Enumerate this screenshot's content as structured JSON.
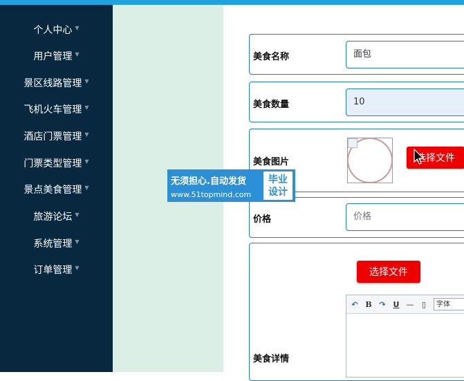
{
  "sidebar": {
    "items": [
      {
        "label": "个人中心"
      },
      {
        "label": "用户管理"
      },
      {
        "label": "景区线路管理"
      },
      {
        "label": "飞机火车管理"
      },
      {
        "label": "酒店门票管理"
      },
      {
        "label": "门票类型管理"
      },
      {
        "label": "景点美食管理"
      },
      {
        "label": "旅游论坛"
      },
      {
        "label": "系统管理"
      },
      {
        "label": "订单管理"
      }
    ]
  },
  "form": {
    "name": {
      "label": "美食名称",
      "value": "面包"
    },
    "quantity": {
      "label": "美食数量",
      "value": "10"
    },
    "image": {
      "label": "美食图片",
      "button": "选择文件"
    },
    "price": {
      "label": "价格",
      "placeholder": "价格"
    },
    "detail": {
      "label": "美食详情",
      "button": "选择文件",
      "toolbar": {
        "bold": "B",
        "underline": "U",
        "font_select": "字体"
      }
    }
  },
  "watermark": {
    "line1": "无须担心.自动发货",
    "url": "www.51topmind.com",
    "badge_line1": "毕业",
    "badge_line2": "设计"
  },
  "colors": {
    "sidebar_bg": "#082840",
    "topbar": "#1fa3e0",
    "accent_border": "#1f7fb0",
    "button_red": "#ee0000",
    "green_pane": "#dcefe6"
  }
}
